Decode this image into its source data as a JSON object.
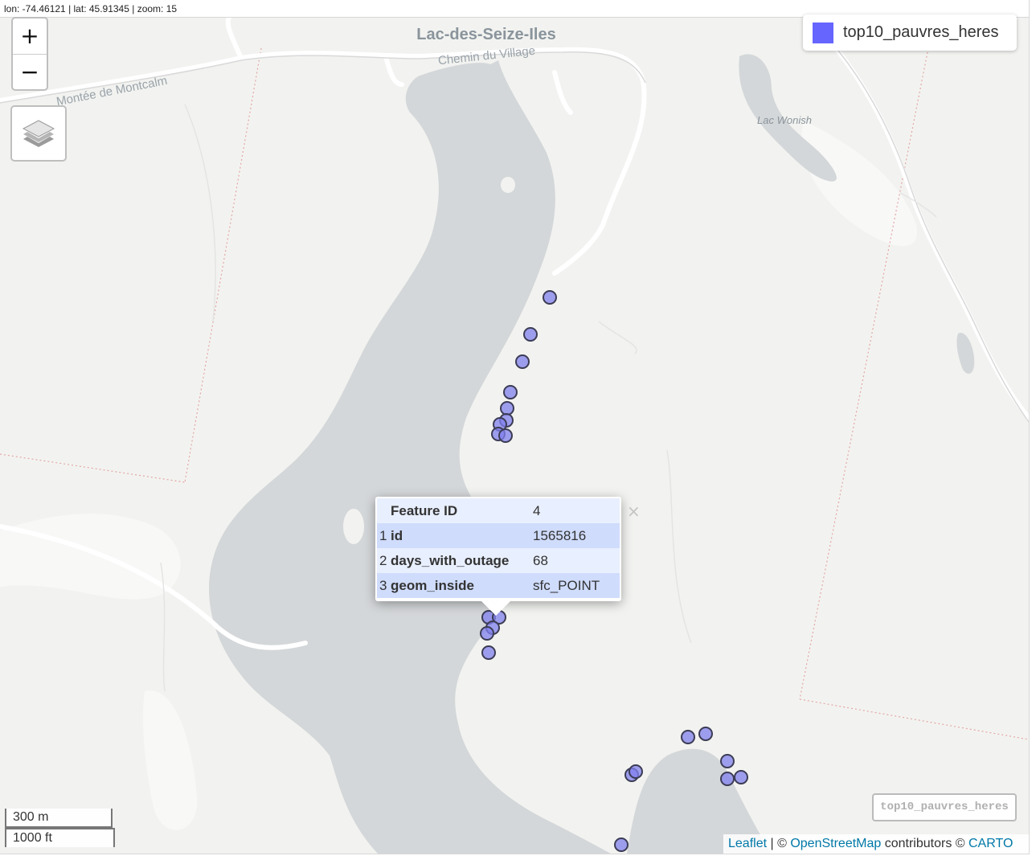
{
  "coords_readout": "lon: -74.46121 | lat: 45.91345 | zoom: 15",
  "zoom": {
    "in_label": "+",
    "out_label": "−"
  },
  "map_labels": {
    "town": "Lac-des-Seize-Iles",
    "road_village": "Chemin du Village",
    "road_montcalm": "Montée de Montcalm",
    "lake_wonish": "Lac Wonish"
  },
  "legend": {
    "label": "top10_pauvres_heres",
    "color": "#6666ff"
  },
  "popup": {
    "header_key": "Feature ID",
    "header_value": "4",
    "rows": [
      {
        "index": "1",
        "key": "id",
        "value": "1565816"
      },
      {
        "index": "2",
        "key": "days_with_outage",
        "value": "68"
      },
      {
        "index": "3",
        "key": "geom_inside",
        "value": "sfc_POINT"
      }
    ],
    "close_label": "×"
  },
  "layer_badge": "top10_pauvres_heres",
  "scale": {
    "metric": "300 m",
    "imperial": "1000 ft"
  },
  "attribution": {
    "leaflet": "Leaflet",
    "sep1": " | © ",
    "osm": "OpenStreetMap",
    "mid": " contributors © ",
    "carto": "CARTO"
  },
  "colors": {
    "land": "#f2f3f0",
    "water": "#d4d7d9",
    "road": "#ffffff",
    "boundary": "#e3a6a6",
    "marker_fill": "#8080ee",
    "marker_stroke": "#3c3c55"
  }
}
